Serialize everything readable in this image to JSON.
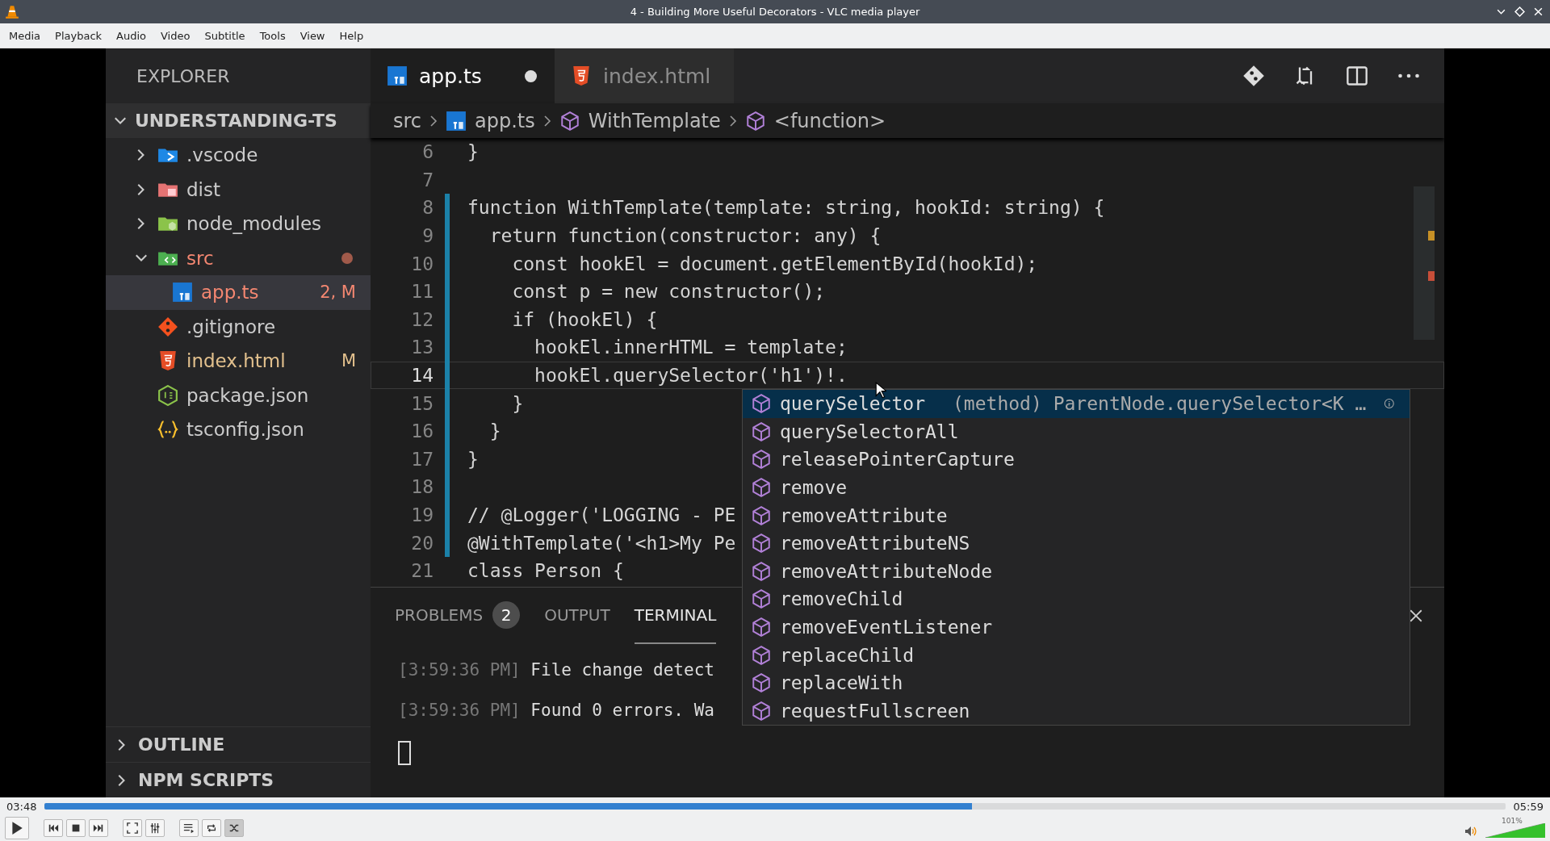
{
  "window": {
    "title": "4 - Building More Useful Decorators - VLC media player"
  },
  "menu": [
    "Media",
    "Playback",
    "Audio",
    "Video",
    "Subtitle",
    "Tools",
    "View",
    "Help"
  ],
  "editor": {
    "sidebar": {
      "title": "EXPLORER",
      "root": {
        "label": "UNDERSTANDING-TS",
        "expanded": true,
        "children": [
          {
            "label": ".vscode",
            "kind": "vscode-folder",
            "expanded": false,
            "selected": false,
            "color": "#cccccc"
          },
          {
            "label": "dist",
            "kind": "dist-folder",
            "expanded": false,
            "selected": false,
            "color": "#cccccc"
          },
          {
            "label": "node_modules",
            "kind": "node-folder",
            "expanded": false,
            "selected": false,
            "color": "#cccccc"
          },
          {
            "label": "src",
            "kind": "src-folder",
            "expanded": true,
            "selected": false,
            "color": "#f48771",
            "children": [
              {
                "label": "app.ts",
                "kind": "ts",
                "selected": true,
                "color": "#f48771",
                "badge": "2, M"
              }
            ]
          },
          {
            "label": ".gitignore",
            "kind": "git",
            "selected": false,
            "color": "#cccccc"
          },
          {
            "label": "index.html",
            "kind": "html",
            "selected": false,
            "color": "#e2c08d",
            "badge": "M"
          },
          {
            "label": "package.json",
            "kind": "node",
            "selected": false,
            "color": "#cccccc"
          },
          {
            "label": "tsconfig.json",
            "kind": "json",
            "selected": false,
            "color": "#cccccc"
          }
        ]
      },
      "sections": [
        {
          "label": "OUTLINE",
          "expanded": false
        },
        {
          "label": "NPM SCRIPTS",
          "expanded": false
        }
      ]
    },
    "tabs": [
      {
        "label": "app.ts",
        "kind": "ts",
        "selected": true,
        "dirty": true
      },
      {
        "label": "index.html",
        "kind": "html",
        "selected": false,
        "dirty": false
      }
    ],
    "breadcrumbs": [
      {
        "label": "src",
        "kind": "folder"
      },
      {
        "label": "app.ts",
        "kind": "ts"
      },
      {
        "label": "WithTemplate",
        "kind": "symbol"
      },
      {
        "label": "<function>",
        "kind": "symbol"
      }
    ],
    "code": [
      {
        "number": "6",
        "text": "}"
      },
      {
        "number": "7"
      },
      {
        "number": "8",
        "text": "function WithTemplate(template: string, hookId: string) {"
      },
      {
        "number": "9",
        "text": "  return function(constructor: any) {"
      },
      {
        "number": "10",
        "text": "    const hookEl = document.getElementById(hookId);"
      },
      {
        "number": "11",
        "text": "    const p = new constructor();"
      },
      {
        "number": "12",
        "text": "    if (hookEl) {"
      },
      {
        "number": "13",
        "text": "      hookEl.innerHTML = template;"
      },
      {
        "number": "14",
        "text": "      hookEl.querySelector('h1')!.",
        "current": true
      },
      {
        "number": "15",
        "text": "    }"
      },
      {
        "number": "16",
        "text": "  }"
      },
      {
        "number": "17",
        "text": "}"
      },
      {
        "number": "18"
      },
      {
        "number": "19",
        "text": "// @Logger('LOGGING - PE"
      },
      {
        "number": "20",
        "text": "@WithTemplate('<h1>My Pe"
      },
      {
        "number": "21",
        "text": "class Person {"
      }
    ],
    "suggestions": [
      {
        "label": "querySelector",
        "selected": true,
        "detail": "(method) ParentNode.querySelector<K …"
      },
      {
        "label": "querySelectorAll",
        "selected": false
      },
      {
        "label": "releasePointerCapture",
        "selected": false
      },
      {
        "label": "remove",
        "selected": false
      },
      {
        "label": "removeAttribute",
        "selected": false
      },
      {
        "label": "removeAttributeNS",
        "selected": false
      },
      {
        "label": "removeAttributeNode",
        "selected": false
      },
      {
        "label": "removeChild",
        "selected": false
      },
      {
        "label": "removeEventListener",
        "selected": false
      },
      {
        "label": "replaceChild",
        "selected": false
      },
      {
        "label": "replaceWith",
        "selected": false
      },
      {
        "label": "requestFullscreen",
        "selected": false
      }
    ],
    "panel": {
      "tabs": [
        {
          "label": "PROBLEMS",
          "badge": "2",
          "selected": false
        },
        {
          "label": "OUTPUT",
          "selected": false
        },
        {
          "label": "TERMINAL",
          "selected": true
        }
      ],
      "lines": [
        {
          "time": "[3:59:36 PM]",
          "text": " File change detect"
        },
        {
          "time": "[3:59:36 PM]",
          "text": " Found 0 errors. Wa"
        }
      ]
    }
  },
  "player": {
    "elapsed": "03:48",
    "total": "05:59",
    "progress": {
      "level": 0.635
    },
    "volume": {
      "reading": "101%",
      "level": 1.0
    }
  }
}
